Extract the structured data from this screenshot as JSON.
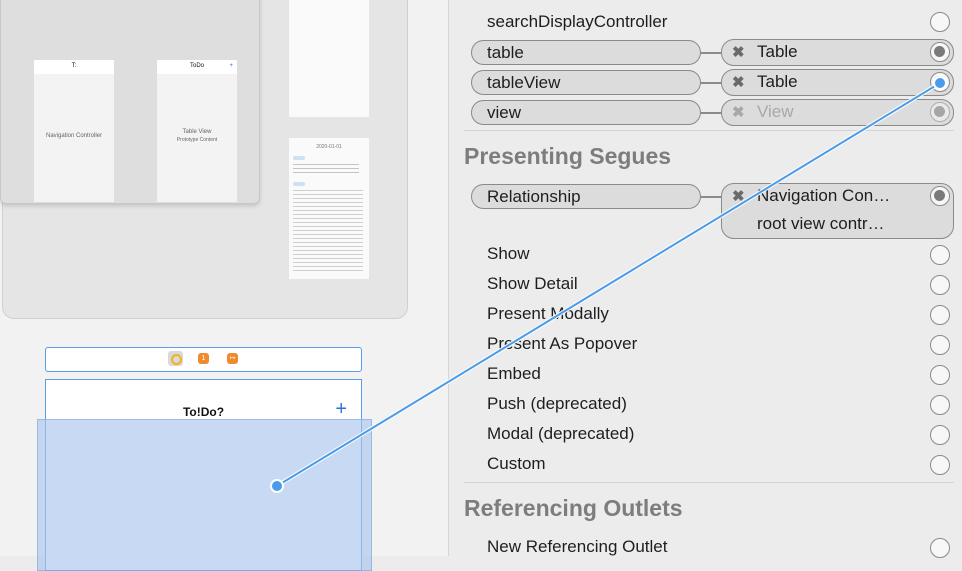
{
  "canvas": {
    "scene_nav": {
      "label": "Navigation Controller"
    },
    "scene_table": {
      "title": "ToDo",
      "label": "Table View",
      "sublabel": "Prototype Content"
    },
    "scene_detail": {
      "title": "2020-01-01"
    },
    "controller": {
      "title": "To!Do?",
      "add_glyph": "+"
    }
  },
  "inspector": {
    "outlets": [
      {
        "label": "searchDisplayController"
      },
      {
        "label": "table",
        "target": "Table"
      },
      {
        "label": "tableView",
        "target": "Table"
      },
      {
        "label": "view",
        "target": "View"
      }
    ],
    "presenting_segues_title": "Presenting Segues",
    "relationship": {
      "label": "Relationship",
      "target_line1": "Navigation Con…",
      "target_line2": "root view contr…"
    },
    "segues": [
      "Show",
      "Show Detail",
      "Present Modally",
      "Present As Popover",
      "Embed",
      "Push (deprecated)",
      "Modal (deprecated)",
      "Custom"
    ],
    "referencing_outlets_title": "Referencing Outlets",
    "new_referencing_outlet": "New Referencing Outlet",
    "remove_glyph": "✖"
  },
  "colors": {
    "accent": "#4a9be8",
    "selection": "#aac4ec"
  }
}
